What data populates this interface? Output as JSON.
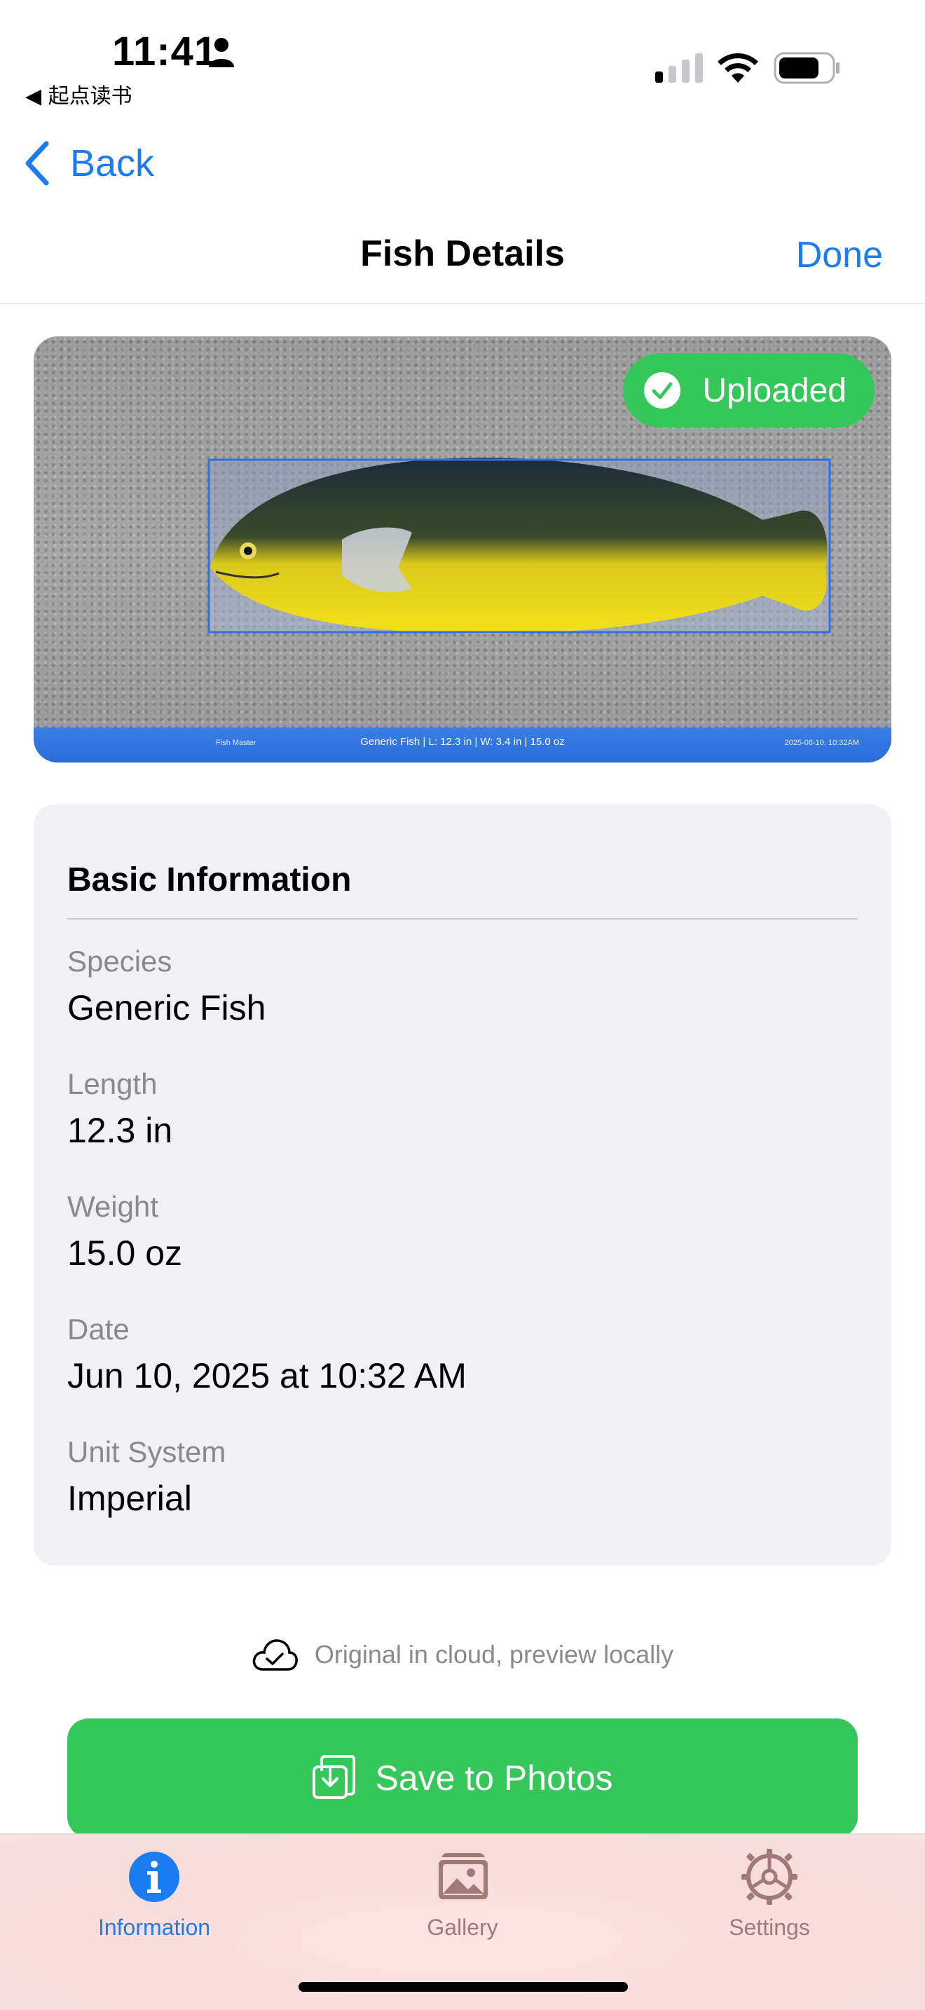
{
  "status_bar": {
    "time": "11:41",
    "back_app_label": "◀ 起点读书"
  },
  "nav": {
    "back_label": "Back",
    "title": "Fish Details",
    "done_label": "Done"
  },
  "photo": {
    "badge_label": "Uploaded",
    "caption_left": "Fish Master",
    "caption_center": "Generic Fish | L: 12.3 in | W: 3.4 in | 15.0 oz",
    "caption_right": "2025-06-10, 10:32AM"
  },
  "info": {
    "section_title": "Basic Information",
    "fields": [
      {
        "label": "Species",
        "value": "Generic Fish"
      },
      {
        "label": "Length",
        "value": "12.3 in"
      },
      {
        "label": "Weight",
        "value": "15.0 oz"
      },
      {
        "label": "Date",
        "value": "Jun 10, 2025 at 10:32 AM"
      },
      {
        "label": "Unit System",
        "value": "Imperial"
      }
    ]
  },
  "cloud_note": "Original in cloud, preview locally",
  "save_button_label": "Save to Photos",
  "tabs": [
    {
      "label": "Information",
      "icon": "info-icon",
      "active": true
    },
    {
      "label": "Gallery",
      "icon": "photos-icon",
      "active": false
    },
    {
      "label": "Settings",
      "icon": "gear-icon",
      "active": false
    }
  ],
  "colors": {
    "accent_blue": "#1a7cf0",
    "success_green": "#35c759",
    "inactive_tab": "#a07a76"
  }
}
